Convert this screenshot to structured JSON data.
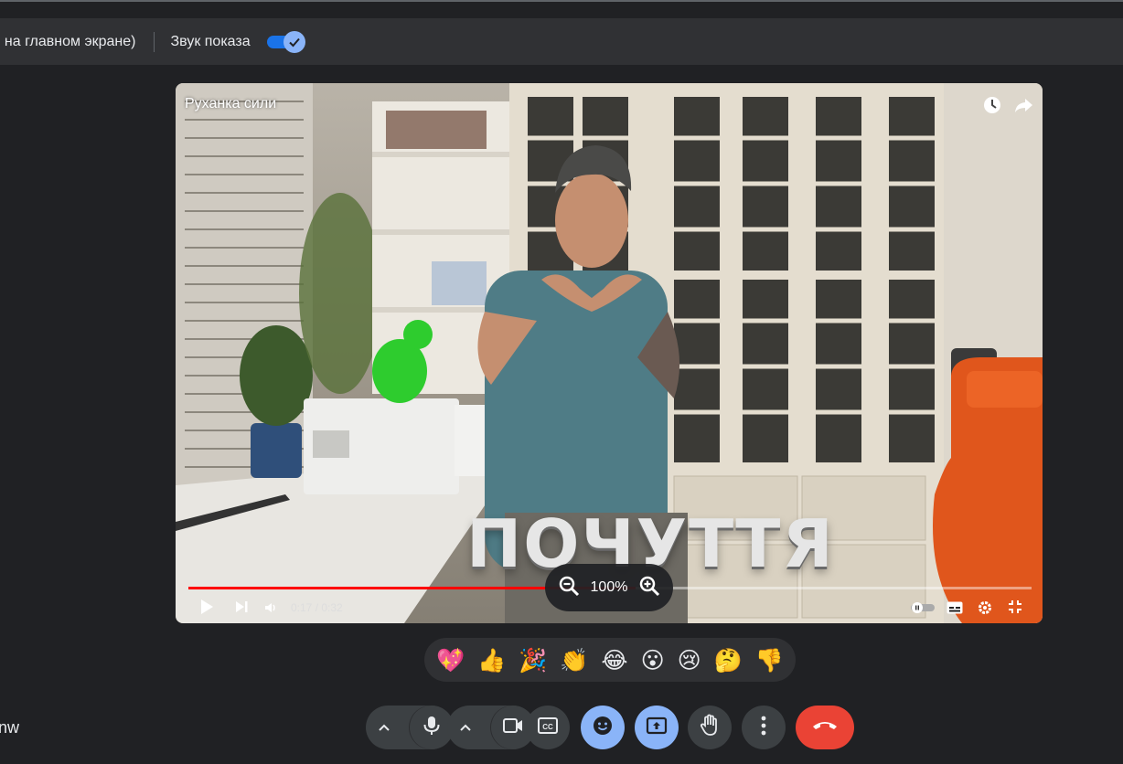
{
  "topbar": {
    "share_text": ", на главном экране)",
    "sound_label": "Звук показа",
    "sound_toggle": "on"
  },
  "video": {
    "title": "Руханка сили",
    "caption": "ПОЧУТТЯ",
    "time": "0:17 / 0:32",
    "progress_fraction": 0.53,
    "zoom": "100%",
    "icons": [
      "watch-later-icon",
      "share-icon",
      "play-icon",
      "next-icon",
      "volume-icon",
      "autoplay-toggle-icon",
      "subtitles-icon",
      "settings-icon",
      "exit-fullscreen-icon",
      "zoom-out-icon",
      "zoom-in-icon"
    ]
  },
  "reactions": [
    "💖",
    "👍",
    "🎉",
    "👏",
    "😂",
    "😮",
    "😢",
    "🤔",
    "👎"
  ],
  "participant_name": "nw",
  "call_controls": [
    "mic-button",
    "camera-button",
    "captions-button",
    "emoji-button",
    "present-button",
    "raise-hand-button",
    "more-options-button",
    "end-call-button"
  ],
  "colors": {
    "background": "#202124",
    "toolbar": "#303134",
    "button": "#3c4043",
    "accent_blue": "#8ab4f8",
    "toggle_track": "#1a73e8",
    "end_call": "#ea4335",
    "progress": "#ff0000"
  }
}
